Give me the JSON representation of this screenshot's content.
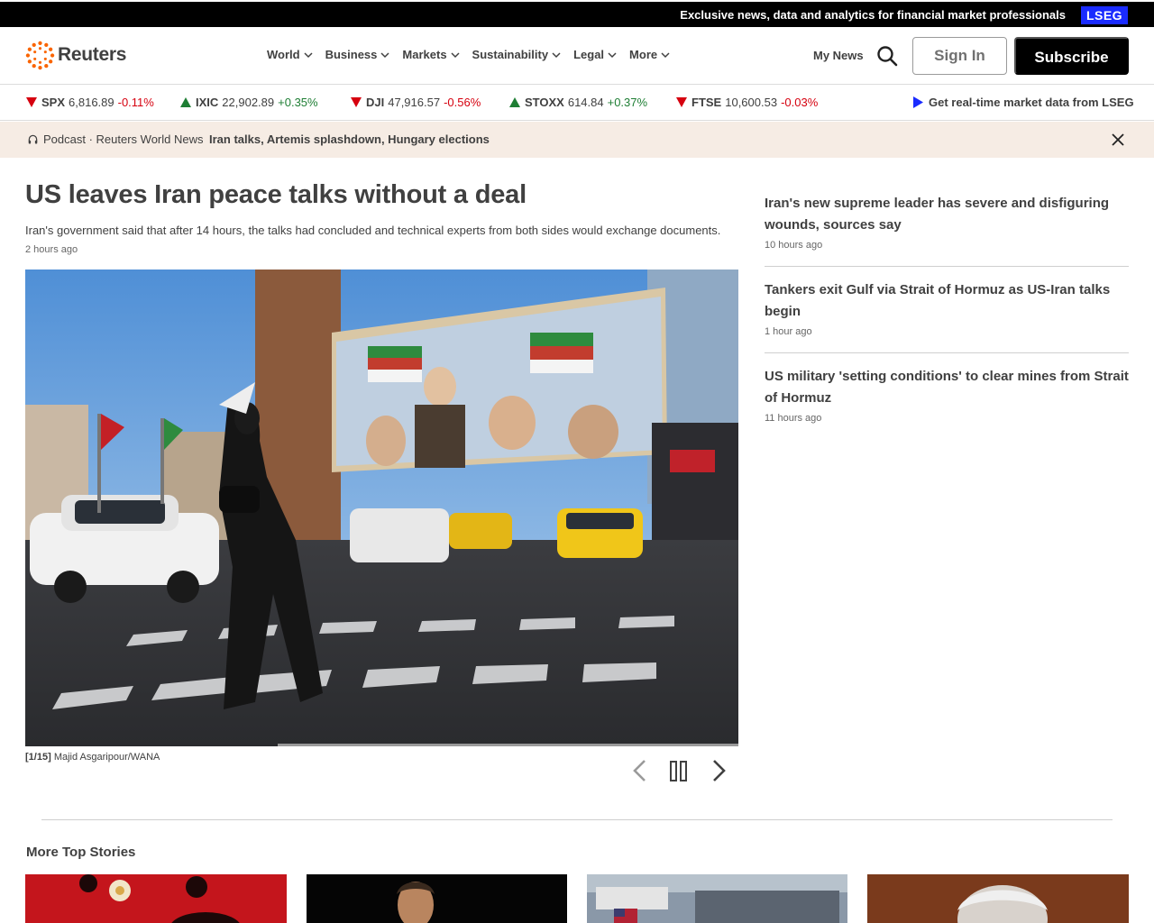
{
  "topbar": {
    "promo": "Exclusive news, data and analytics for financial market professionals",
    "badge": "LSEG"
  },
  "header": {
    "logo_text": "Reuters",
    "nav": [
      {
        "label": "World"
      },
      {
        "label": "Business"
      },
      {
        "label": "Markets"
      },
      {
        "label": "Sustainability"
      },
      {
        "label": "Legal"
      },
      {
        "label": "More"
      }
    ],
    "my_news": "My News",
    "sign_in": "Sign In",
    "subscribe": "Subscribe"
  },
  "ticker": {
    "items": [
      {
        "symbol": "SPX",
        "value": "6,816.89",
        "change": "-0.11%",
        "direction": "down"
      },
      {
        "symbol": "IXIC",
        "value": "22,902.89",
        "change": "+0.35%",
        "direction": "up"
      },
      {
        "symbol": "DJI",
        "value": "47,916.57",
        "change": "-0.56%",
        "direction": "down"
      },
      {
        "symbol": "STOXX",
        "value": "614.84",
        "change": "+0.37%",
        "direction": "up"
      },
      {
        "symbol": "FTSE",
        "value": "10,600.53",
        "change": "-0.03%",
        "direction": "down"
      }
    ],
    "lseg_link": "Get real-time market data from LSEG"
  },
  "podcast": {
    "label": "Podcast · Reuters World News",
    "title": "Iran talks, Artemis splashdown, Hungary elections"
  },
  "article": {
    "headline": "US leaves Iran peace talks without a deal",
    "summary": "Iran's government said that after 14 hours, the talks had concluded and technical experts from both sides would exchange documents.",
    "timestamp": "2 hours ago",
    "caption_index": "[1/15]",
    "caption_credit": "Majid Asgaripour/WANA"
  },
  "sidebar": [
    {
      "title": "Iran's new supreme leader has severe and disfiguring wounds, sources say",
      "time": "10 hours ago"
    },
    {
      "title": "Tankers exit Gulf via Strait of Hormuz as US-Iran talks begin",
      "time": "1 hour ago"
    },
    {
      "title": "US military 'setting conditions' to clear mines from Strait of Hormuz",
      "time": "11 hours ago"
    }
  ],
  "more_top_stories": {
    "title": "More Top Stories"
  },
  "colors": {
    "down": "#d6000f",
    "up": "#1e7e34",
    "lseg_blue": "#1a2bff",
    "logo_orange": "#fa6400",
    "podcast_bg": "#f6ece4"
  },
  "icons": {
    "logo": "reuters-dots-icon",
    "search": "search-icon",
    "close": "close-icon",
    "headphones": "headphones-icon",
    "prev": "chevron-left-icon",
    "pause": "pause-icon",
    "next": "chevron-right-icon"
  }
}
